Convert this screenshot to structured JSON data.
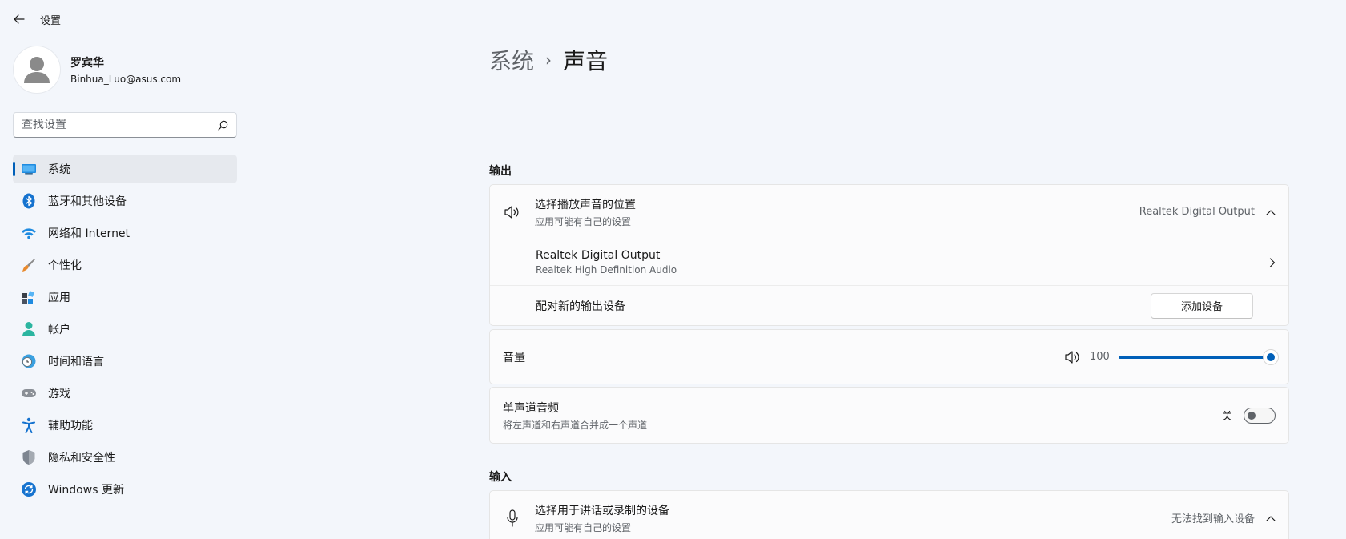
{
  "window": {
    "title": "设置"
  },
  "profile": {
    "name": "罗宾华",
    "email": "Binhua_Luo@asus.com"
  },
  "search": {
    "placeholder": "查找设置"
  },
  "nav": {
    "items": [
      {
        "label": "系统",
        "icon": "system-icon",
        "active": true
      },
      {
        "label": "蓝牙和其他设备",
        "icon": "bluetooth-icon"
      },
      {
        "label": "网络和 Internet",
        "icon": "wifi-icon"
      },
      {
        "label": "个性化",
        "icon": "brush-icon"
      },
      {
        "label": "应用",
        "icon": "apps-icon"
      },
      {
        "label": "帐户",
        "icon": "account-icon"
      },
      {
        "label": "时间和语言",
        "icon": "clock-globe-icon"
      },
      {
        "label": "游戏",
        "icon": "gamepad-icon"
      },
      {
        "label": "辅助功能",
        "icon": "accessibility-icon"
      },
      {
        "label": "隐私和安全性",
        "icon": "shield-icon"
      },
      {
        "label": "Windows 更新",
        "icon": "update-icon"
      }
    ]
  },
  "breadcrumb": {
    "parent": "系统",
    "separator": "›",
    "current": "声音"
  },
  "output": {
    "section_title": "输出",
    "choose": {
      "label": "选择播放声音的位置",
      "sub": "应用可能有自己的设置",
      "value": "Realtek Digital Output"
    },
    "device": {
      "label": "Realtek Digital Output",
      "sub": "Realtek High Definition Audio"
    },
    "pair": {
      "label": "配对新的输出设备",
      "button": "添加设备"
    },
    "volume": {
      "label": "音量",
      "value": "100",
      "level": 100
    },
    "mono": {
      "label": "单声道音频",
      "sub": "将左声道和右声道合并成一个声道",
      "state": "关",
      "on": false
    }
  },
  "input": {
    "section_title": "输入",
    "choose": {
      "label": "选择用于讲话或录制的设备",
      "sub": "应用可能有自己的设置",
      "value": "无法找到输入设备"
    }
  },
  "colors": {
    "accent": "#005fb8",
    "background": "#f3f6fb",
    "card": "#fbfbfc"
  }
}
